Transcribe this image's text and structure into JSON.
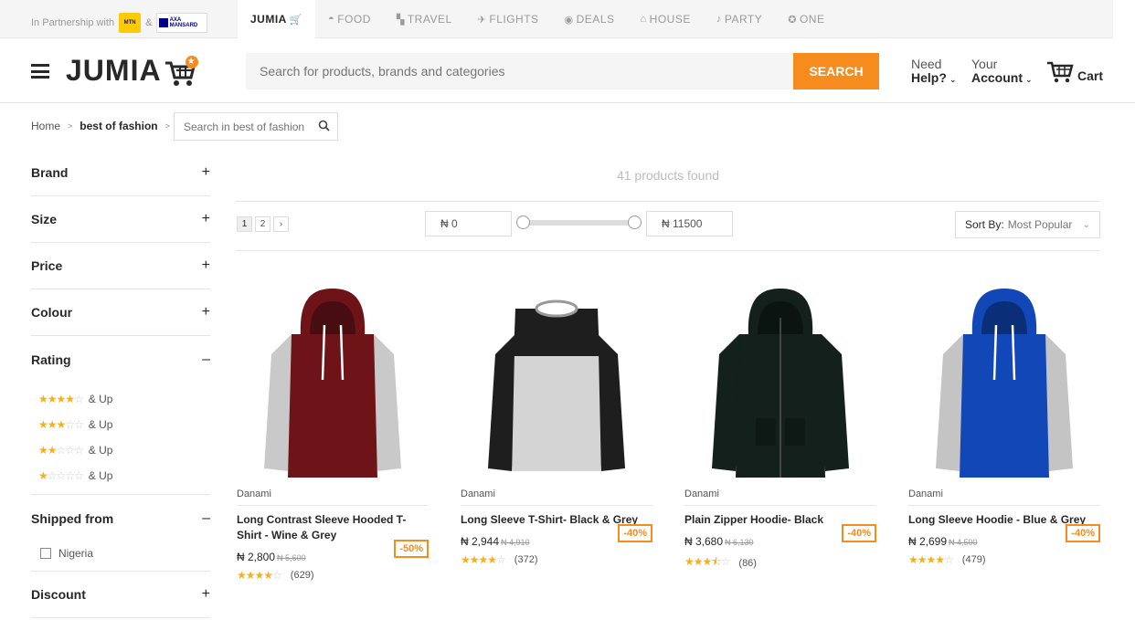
{
  "partner": {
    "text": "In Partnership with",
    "amp": "&",
    "mtn": "MTN",
    "axa": "AXA MANSARD"
  },
  "top_tabs": [
    {
      "label": "JUMIA",
      "icon": "jumia-cart-icon"
    },
    {
      "label": "FOOD",
      "icon": "food-icon"
    },
    {
      "label": "TRAVEL",
      "icon": "travel-icon"
    },
    {
      "label": "FLIGHTS",
      "icon": "flights-icon"
    },
    {
      "label": "DEALS",
      "icon": "deals-icon"
    },
    {
      "label": "HOUSE",
      "icon": "house-icon"
    },
    {
      "label": "PARTY",
      "icon": "party-icon"
    },
    {
      "label": "ONE",
      "icon": "one-icon"
    }
  ],
  "header": {
    "logo": "JUMIA",
    "search_placeholder": "Search for products, brands and categories",
    "search_button": "SEARCH",
    "need": "Need",
    "help": "Help?",
    "your": "Your",
    "account": "Account",
    "cart": "Cart"
  },
  "breadcrumb": {
    "home": "Home",
    "current": "best of fashion",
    "search_placeholder": "Search in best of fashion"
  },
  "filters": {
    "brand": "Brand",
    "size": "Size",
    "price": "Price",
    "colour": "Colour",
    "rating": "Rating",
    "shipped_from": "Shipped from",
    "discount": "Discount",
    "rating_options": [
      {
        "stars": 4,
        "label": "& Up"
      },
      {
        "stars": 3,
        "label": "& Up"
      },
      {
        "stars": 2,
        "label": "& Up"
      },
      {
        "stars": 1,
        "label": "& Up"
      }
    ],
    "ship_option": "Nigeria"
  },
  "listing": {
    "found": "41 products found",
    "pages": [
      "1",
      "2",
      "›"
    ],
    "price_min": "₦ 0",
    "price_max": "₦ 11500",
    "sort_label": "Sort By:",
    "sort_value": "Most Popular"
  },
  "products": [
    {
      "brand": "Danami",
      "name": "Long Contrast Sleeve Hooded T-Shirt - Wine & Grey",
      "price": "₦ 2,800",
      "old": "₦ 5,600",
      "discount": "-50%",
      "rating": 4,
      "reviews": "(629)",
      "body": "#6e1419",
      "sleeve": "#c9c9c9",
      "style": "hoodie"
    },
    {
      "brand": "Danami",
      "name": "Long Sleeve T-Shirt- Black & Grey",
      "price": "₦ 2,944",
      "old": "₦ 4,910",
      "discount": "-40%",
      "rating": 4,
      "reviews": "(372)",
      "body": "#d4d4d4",
      "sleeve": "#1e1e1e",
      "style": "tee"
    },
    {
      "brand": "Danami",
      "name": "Plain Zipper Hoodie- Black",
      "price": "₦ 3,680",
      "old": "₦ 6,130",
      "discount": "-40%",
      "rating": 3.5,
      "reviews": "(86)",
      "body": "#13201b",
      "sleeve": "#13201b",
      "style": "zip"
    },
    {
      "brand": "Danami",
      "name": "Long Sleeve Hoodie - Blue & Grey",
      "price": "₦ 2,699",
      "old": "₦ 4,500",
      "discount": "-40%",
      "rating": 4,
      "reviews": "(479)",
      "body": "#1247b8",
      "sleeve": "#c4c4c4",
      "style": "hoodie"
    }
  ],
  "colors": {
    "accent": "#f68b1e",
    "star": "#f6b01e"
  }
}
